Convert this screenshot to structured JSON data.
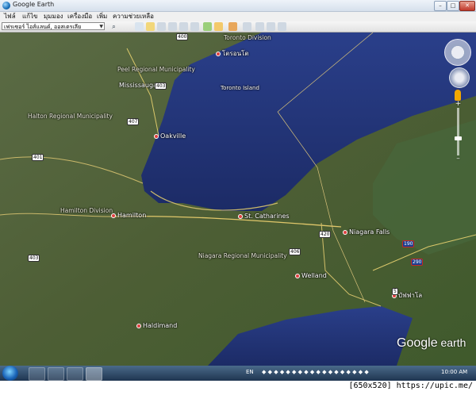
{
  "window": {
    "title": "Google Earth",
    "minimize": "–",
    "maximize": "□",
    "close": "✕"
  },
  "menu": [
    "ไฟล์",
    "แก้ไข",
    "มุมมอง",
    "เครื่องมือ",
    "เพิ่ม",
    "ความช่วยเหลือ"
  ],
  "toolbar": {
    "search_value": "เฟรเซอร์ ไอส์แลนด์, ออสเตรเลีย"
  },
  "map": {
    "labels": {
      "toronto_division": "Toronto Division",
      "toronto": "โตรอนโต",
      "peel": "Peel Regional Municipality",
      "mississauga": "Mississauga",
      "toronto_island": "Toronto Island",
      "halton": "Halton Regional Municipality",
      "oakville": "Oakville",
      "hamilton_div": "Hamilton Division",
      "hamilton": "Hamilton",
      "st_catharines": "St. Catharines",
      "niagara_falls": "Niagara Falls",
      "niagara_regional": "Niagara Regional Municipality",
      "welland": "Welland",
      "haldimand": "Haldimand",
      "buffalo": "บัฟฟาโล"
    },
    "shields": [
      "400",
      "401",
      "403",
      "407",
      "403",
      "406",
      "420",
      "190",
      "290",
      "5"
    ],
    "watermark_brand": "Google",
    "watermark_product": " earth"
  },
  "taskbar": {
    "lang": "EN",
    "time": "10:00 AM"
  },
  "caption": "[650x520] https://upic.me/"
}
